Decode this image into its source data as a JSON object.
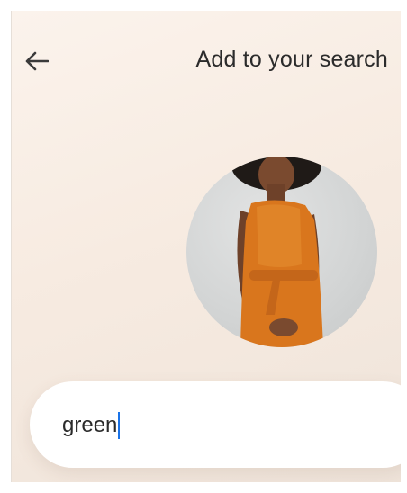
{
  "header": {
    "title": "Add to your search",
    "back_icon": "arrow-left-icon"
  },
  "query_image": {
    "icon": "photo-thumbnail",
    "colors": {
      "dress": "#d9761d",
      "background": "#d4d6d6",
      "skin": "#7a4a2f",
      "hair": "#1f1a17"
    }
  },
  "search": {
    "value": "green",
    "caret_color": "#1a73e8"
  },
  "colors": {
    "background": "#f7ebe1",
    "text": "#2b2b2b"
  }
}
